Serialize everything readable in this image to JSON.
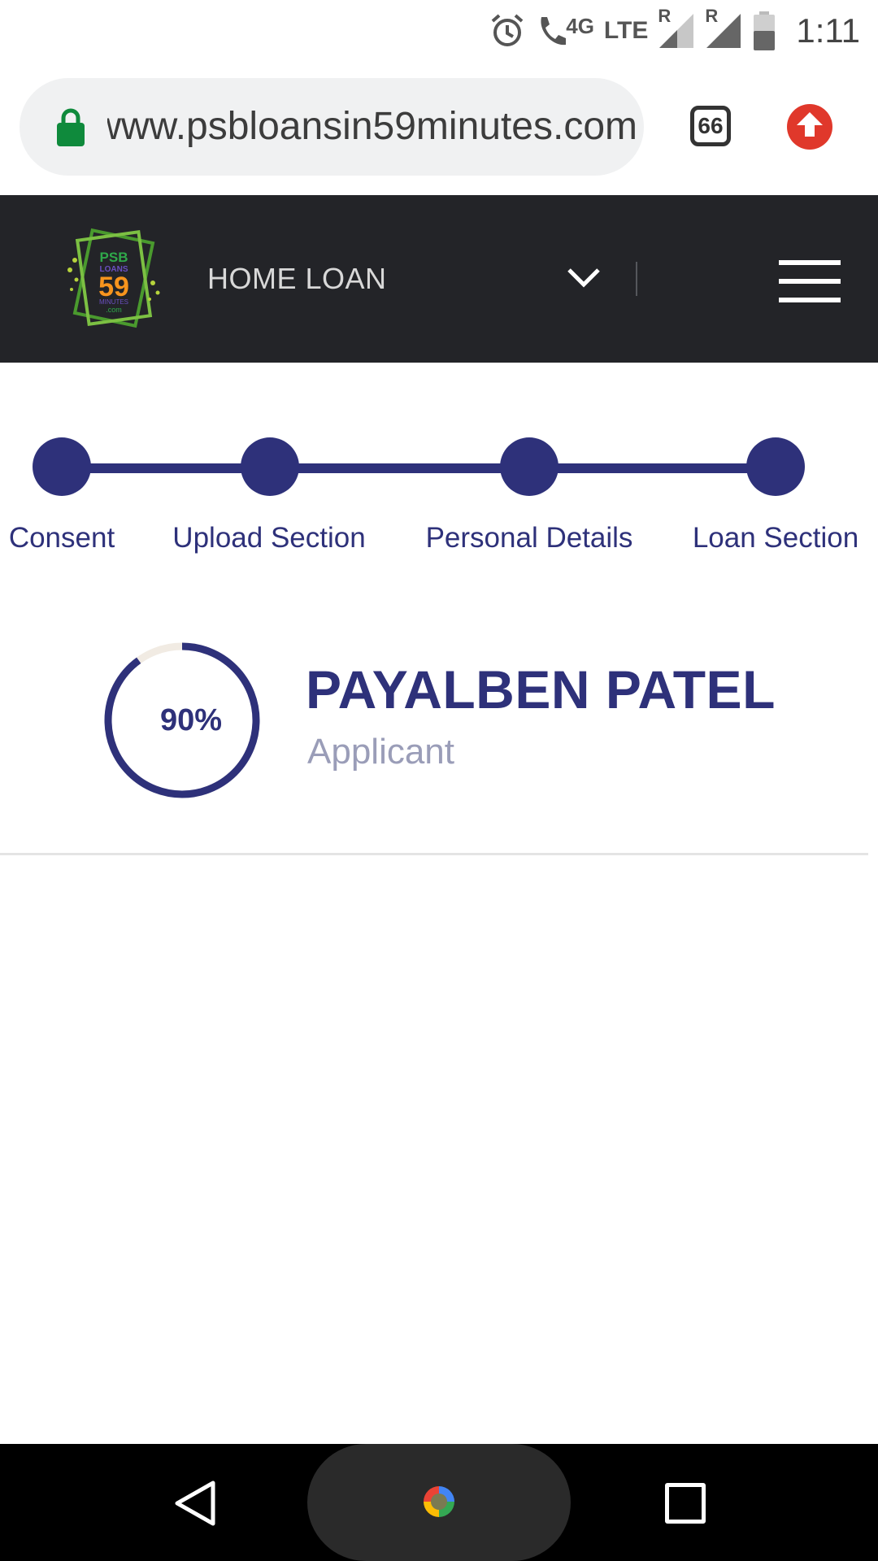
{
  "status_bar": {
    "time": "1:11",
    "network_type": "4G",
    "lte_label": "LTE",
    "roaming_1": "R",
    "roaming_2": "R"
  },
  "browser": {
    "url": "www.psbloansin59minutes.com",
    "tab_count": "66"
  },
  "header": {
    "logo_text": "PSB LOANS 59 MINUTES .com",
    "loan_type": "HOME LOAN"
  },
  "stepper": {
    "steps": [
      {
        "label": "Consent"
      },
      {
        "label": "Upload Section"
      },
      {
        "label": "Personal Details"
      },
      {
        "label": "Loan Section"
      }
    ]
  },
  "applicant": {
    "progress": 0.9,
    "progress_label": "90%",
    "name": "PAYALBEN PATEL",
    "role": "Applicant"
  },
  "colors": {
    "brand_navy": "#2e317a",
    "header_dark": "#232428",
    "muted_text": "#9a9db8",
    "ring_track": "#f1ebe3",
    "lock_green": "#0f8a3c",
    "update_red": "#e0382b"
  }
}
